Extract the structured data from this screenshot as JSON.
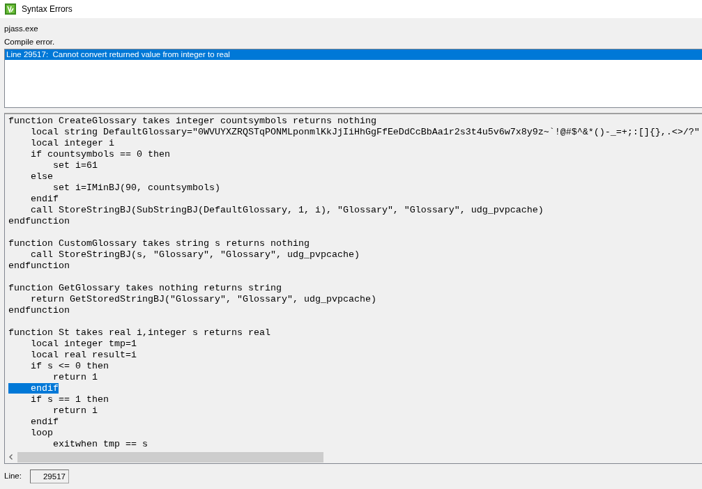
{
  "window": {
    "title": "Syntax Errors"
  },
  "program": "pjass.exe",
  "message": "Compile error.",
  "errors": [
    {
      "text": "Line 29517:  Cannot convert returned value from integer to real",
      "selected": true
    }
  ],
  "code": {
    "lines": [
      {
        "kind": "code",
        "text": "function CreateGlossary takes integer countsymbols returns nothing",
        "selected": false
      },
      {
        "kind": "code",
        "text": "    local string DefaultGlossary=\"0WVUYXZRQSTqPONMLponmlKkJjIiHhGgFfEeDdCcBbAa1r2s3t4u5v6w7x8y9z~`!@#$^&*()-_=+;:[]{},.<>/?\"",
        "selected": false
      },
      {
        "kind": "code",
        "text": "    local integer i",
        "selected": false
      },
      {
        "kind": "code",
        "text": "    if countsymbols == 0 then",
        "selected": false
      },
      {
        "kind": "code",
        "text": "        set i=61",
        "selected": false
      },
      {
        "kind": "code",
        "text": "    else",
        "selected": false
      },
      {
        "kind": "code",
        "text": "        set i=IMinBJ(90, countsymbols)",
        "selected": false
      },
      {
        "kind": "code",
        "text": "    endif",
        "selected": false
      },
      {
        "kind": "code",
        "text": "    call StoreStringBJ(SubStringBJ(DefaultGlossary, 1, i), \"Glossary\", \"Glossary\", udg_pvpcache)",
        "selected": false
      },
      {
        "kind": "code",
        "text": "endfunction",
        "selected": false
      },
      {
        "kind": "blank"
      },
      {
        "kind": "code",
        "text": "function CustomGlossary takes string s returns nothing",
        "selected": false
      },
      {
        "kind": "code",
        "text": "    call StoreStringBJ(s, \"Glossary\", \"Glossary\", udg_pvpcache)",
        "selected": false
      },
      {
        "kind": "code",
        "text": "endfunction",
        "selected": false
      },
      {
        "kind": "blank"
      },
      {
        "kind": "code",
        "text": "function GetGlossary takes nothing returns string",
        "selected": false
      },
      {
        "kind": "code",
        "text": "    return GetStoredStringBJ(\"Glossary\", \"Glossary\", udg_pvpcache)",
        "selected": false
      },
      {
        "kind": "code",
        "text": "endfunction",
        "selected": false
      },
      {
        "kind": "blank"
      },
      {
        "kind": "code",
        "text": "function St takes real i,integer s returns real",
        "selected": false
      },
      {
        "kind": "code",
        "text": "    local integer tmp=1",
        "selected": false
      },
      {
        "kind": "code",
        "text": "    local real result=i",
        "selected": false
      },
      {
        "kind": "code",
        "text": "    if s <= 0 then",
        "selected": false
      },
      {
        "kind": "code",
        "text": "        return 1",
        "selected": false
      },
      {
        "kind": "code",
        "text": "    endif",
        "selected": true
      },
      {
        "kind": "code",
        "text": "    if s == 1 then",
        "selected": false
      },
      {
        "kind": "code",
        "text": "        return i",
        "selected": false
      },
      {
        "kind": "code",
        "text": "    endif",
        "selected": false
      },
      {
        "kind": "code",
        "text": "    loop",
        "selected": false
      },
      {
        "kind": "code",
        "text": "        exitwhen tmp == s",
        "selected": false
      }
    ]
  },
  "line_field": {
    "label": "Line:",
    "value": "29517"
  }
}
